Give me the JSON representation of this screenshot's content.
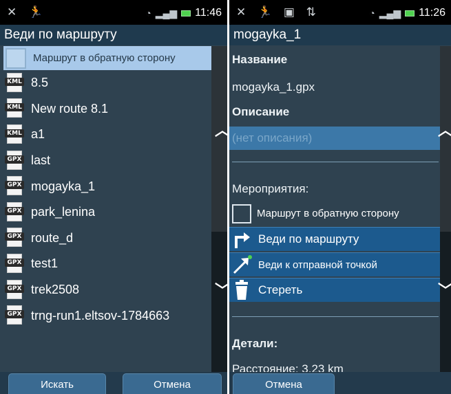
{
  "status_left": {
    "time": "11:46",
    "icons": [
      "crossed-arrow-icon",
      "running-person-icon",
      "wifi-icon",
      "signal-icon",
      "battery-icon"
    ]
  },
  "status_right": {
    "time": "11:26",
    "icons": [
      "crossed-arrow-icon",
      "running-person-icon",
      "picture-icon",
      "sync-icon",
      "wifi-icon",
      "signal-icon",
      "battery-icon"
    ]
  },
  "route_screen": {
    "title": "Веди по маршруту",
    "reverse_label": "Маршрут в обратную сторону",
    "routes": [
      {
        "type": "KML",
        "name": "8.5"
      },
      {
        "type": "KML",
        "name": "New route 8.1"
      },
      {
        "type": "KML",
        "name": "a1"
      },
      {
        "type": "GPX",
        "name": "last"
      },
      {
        "type": "GPX",
        "name": "mogayka_1"
      },
      {
        "type": "GPX",
        "name": "park_lenina"
      },
      {
        "type": "GPX",
        "name": "route_d"
      },
      {
        "type": "GPX",
        "name": "test1"
      },
      {
        "type": "GPX",
        "name": "trek2508"
      },
      {
        "type": "GPX",
        "name": "trng-run1.eltsov-1784663"
      }
    ],
    "search_button": "Искать",
    "cancel_button": "Отмена"
  },
  "detail_screen": {
    "title": "mogayka_1",
    "name_heading": "Название",
    "name_value": "mogayka_1.gpx",
    "description_heading": "Описание",
    "description_placeholder": "(нет описания)",
    "actions_heading": "Мероприятия:",
    "reverse_label": "Маршрут в обратную сторону",
    "follow_route": "Веди по маршруту",
    "go_to_start": "Веди к отправной точкой",
    "delete": "Стереть",
    "details_heading": "Детали:",
    "distance_partial": "Расстояние: 3.23 km",
    "cancel_button": "Отмена"
  },
  "colors": {
    "background": "#2f4250",
    "selected_row": "#a8c9ea",
    "action_row": "#1c5a8e",
    "button": "#3a6a91"
  }
}
